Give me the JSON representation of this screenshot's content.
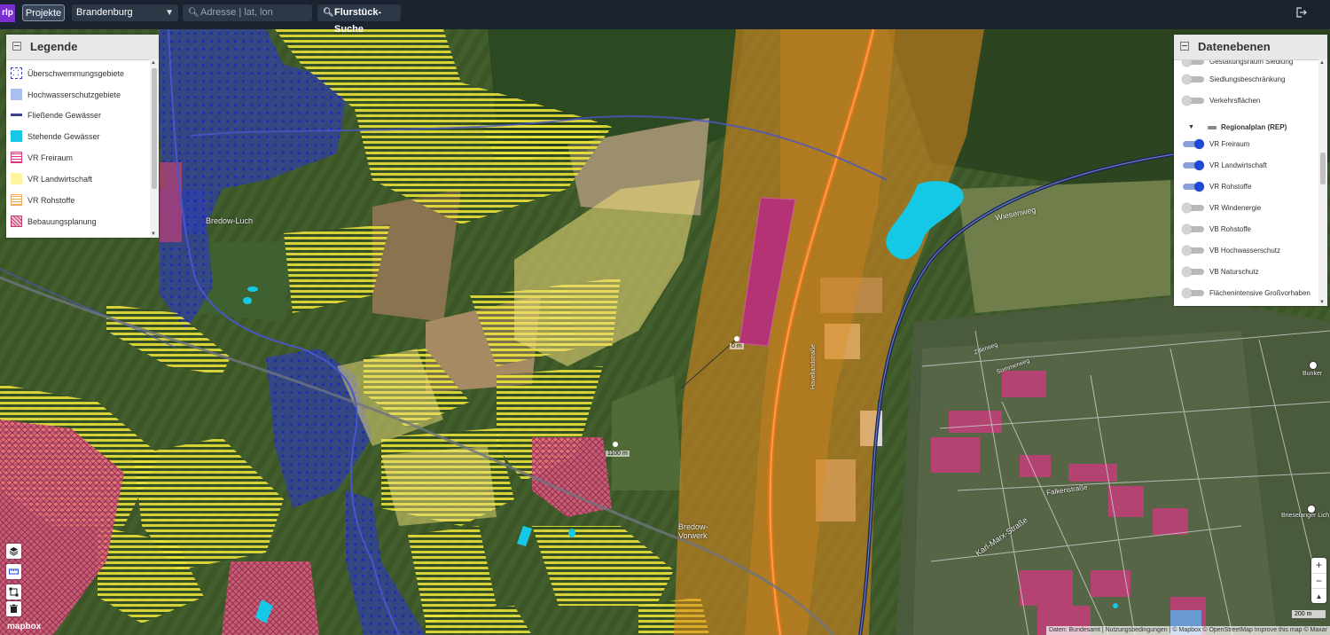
{
  "topbar": {
    "logo": "rlp",
    "projects_button": "Projekte",
    "state_select": "Brandenburg",
    "address_placeholder": "Adresse | lat, lon",
    "parcel_search_button": "Flurstück-Suche"
  },
  "legend": {
    "title": "Legende",
    "items": [
      {
        "label": "Überschwemmungsgebiete",
        "color": "#3a44b8"
      },
      {
        "label": "Hochwasserschutzgebiete",
        "color": "#a9c0ee"
      },
      {
        "label": "Fließende Gewässer",
        "color": "#3b3f8c"
      },
      {
        "label": "Stehende Gewässer",
        "color": "#14c8e6"
      },
      {
        "label": "VR Freiraum",
        "color": "#e0357e"
      },
      {
        "label": "VR Landwirtschaft",
        "color": "#fff3a0"
      },
      {
        "label": "VR Rohstoffe",
        "color": "#f2a95a"
      },
      {
        "label": "Bebauungsplanung",
        "color": "#c04070"
      }
    ]
  },
  "layers": {
    "title": "Datenebenen",
    "items": [
      {
        "label": "Gestaltungsraum Siedlung",
        "on": false
      },
      {
        "label": "Siedlungsbeschränkung",
        "on": false
      },
      {
        "label": "Verkehrsflächen",
        "on": false
      }
    ],
    "group_label": "Regionalplan (REP)",
    "group_items": [
      {
        "label": "VR Freiraum",
        "on": true
      },
      {
        "label": "VR Landwirtschaft",
        "on": true
      },
      {
        "label": "VR Rohstoffe",
        "on": true
      },
      {
        "label": "VR Windenergie",
        "on": false
      },
      {
        "label": "VB Rohstoffe",
        "on": false
      },
      {
        "label": "VB Hochwasserschutz",
        "on": false
      },
      {
        "label": "VB Naturschutz",
        "on": false
      },
      {
        "label": "Flächenintensive Großvorhaben",
        "on": false
      }
    ]
  },
  "map_labels": {
    "bredow_luch": "Bredow-Luch",
    "bredow_vorwerk_1": "Bredow-",
    "bredow_vorwerk_2": "Vorwerk",
    "wiesenweg": "Wiesenweg",
    "zillerweg": "Zillerweg",
    "sommerweg": "Sommerweg",
    "falkenstrasse": "Falkenstraße",
    "karl_marx_strasse": "Karl-Marx-Straße",
    "bunker": "Bunker",
    "brieselanger": "Brieselanger Lich",
    "havellandstrasse": "Havellandstraße",
    "dist_0": "0 m",
    "dist_1": "1100 m"
  },
  "zoom": {
    "in": "+",
    "out": "−",
    "north": "▲"
  },
  "scale_label": "200 m",
  "attribution": "Daten: Bundesamt | Nutzungsbedingungen | © Mapbox © OpenStreetMap Improve this map © Maxar",
  "mapbox_logo": "mapbox",
  "colors": {
    "accent": "#1c49d8",
    "topbar": "#1b2330",
    "highway": "#e0781a",
    "rohstoffe_buffer": "#e08a1e",
    "bebauung": "#b5307a"
  }
}
